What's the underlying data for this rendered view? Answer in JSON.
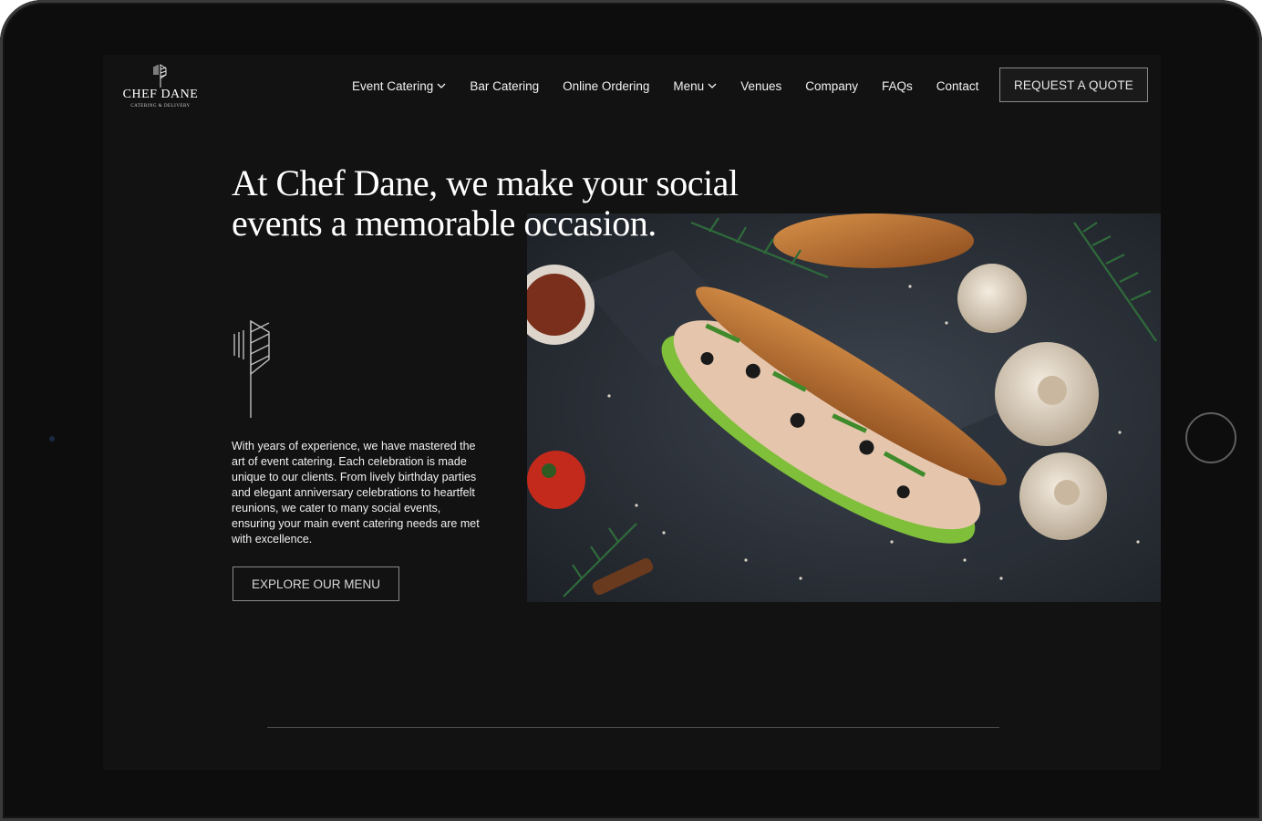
{
  "brand": {
    "name": "CHEF DANE",
    "tagline": "CATERING & DELIVERY"
  },
  "nav": {
    "items": [
      {
        "label": "Event Catering",
        "has_dropdown": true
      },
      {
        "label": "Bar Catering",
        "has_dropdown": false
      },
      {
        "label": "Online Ordering",
        "has_dropdown": false
      },
      {
        "label": "Menu",
        "has_dropdown": true
      },
      {
        "label": "Venues",
        "has_dropdown": false
      },
      {
        "label": "Company",
        "has_dropdown": false
      },
      {
        "label": "FAQs",
        "has_dropdown": false
      },
      {
        "label": "Contact",
        "has_dropdown": false
      }
    ],
    "cta_label": "REQUEST A QUOTE"
  },
  "hero": {
    "headline_line1": "At Chef Dane, we make your social",
    "headline_line2": "events a memorable occasion.",
    "body": "With years of experience, we have mastered the art of event catering. Each celebration is made unique to our clients. From lively birthday parties and elegant anniversary celebrations to heartfelt reunions, we cater to many social events, ensuring your main event catering needs are met with excellence.",
    "cta_label": "EXPLORE OUR MENU",
    "image_icon": "sandwich-photo"
  },
  "colors": {
    "background": "#121212",
    "device_frame": "#0d0d0d",
    "text": "#ffffff",
    "button_border": "#8a8a8a"
  }
}
